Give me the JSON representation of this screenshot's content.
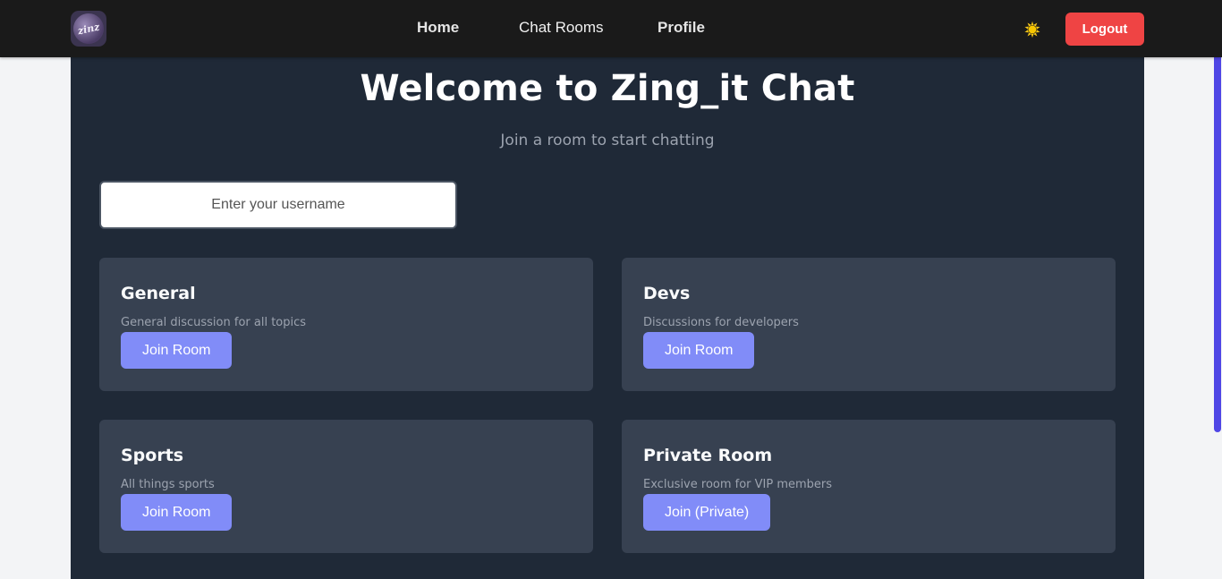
{
  "nav": {
    "logo_text": "zinz",
    "links": [
      "Home",
      "Chat Rooms",
      "Profile"
    ],
    "theme_icon": "sun-icon",
    "logout_label": "Logout"
  },
  "main": {
    "title": "Welcome to Zing_it Chat",
    "subtitle": "Join a room to start chatting",
    "username_placeholder": "Enter your username"
  },
  "rooms": [
    {
      "name": "General",
      "description": "General discussion for all topics",
      "button": "Join Room"
    },
    {
      "name": "Devs",
      "description": "Discussions for developers",
      "button": "Join Room"
    },
    {
      "name": "Sports",
      "description": "All things sports",
      "button": "Join Room"
    },
    {
      "name": "Private Room",
      "description": "Exclusive room for VIP members",
      "button": "Join (Private)"
    }
  ],
  "colors": {
    "navbar": "#1a1a1a",
    "background": "#1f2937",
    "card": "#374151",
    "accent": "#818cf8",
    "logout": "#ef4444",
    "scrollbar": "#4f46e5"
  }
}
